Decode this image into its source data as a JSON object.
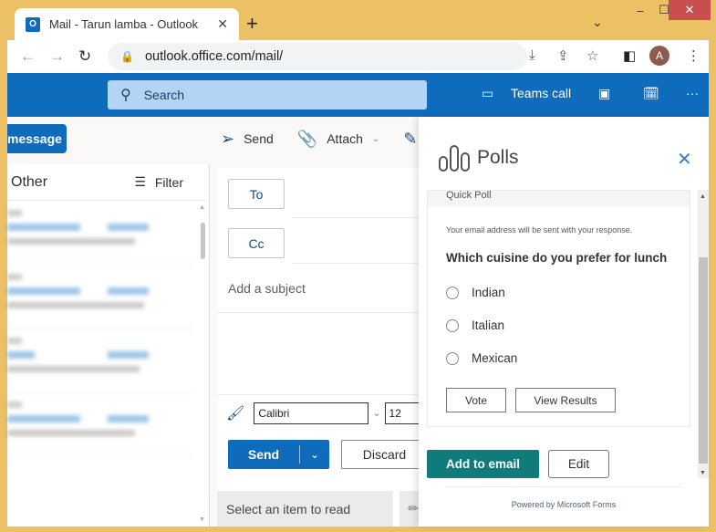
{
  "browser": {
    "tab_title": "Mail - Tarun lamba - Outlook",
    "favicon_letter": "O",
    "tab_close": "✕",
    "new_tab": "+",
    "url": "outlook.office.com/mail/",
    "profile_initial": "A",
    "window_controls": {
      "minimize": "–",
      "maximize": "☐",
      "close": "✕"
    }
  },
  "outlook_header": {
    "search_placeholder": "Search",
    "teams_call_label": "Teams call"
  },
  "left": {
    "new_message_label": "message",
    "folder_label": "Other",
    "filter_label": "Filter",
    "mail_items_count_visible": 4
  },
  "commands": {
    "send_label": "Send",
    "attach_label": "Attach"
  },
  "compose": {
    "to_label": "To",
    "cc_label": "Cc",
    "subject_placeholder": "Add a subject",
    "font_name": "Calibri",
    "font_size": "12",
    "send_label": "Send",
    "discard_label": "Discard",
    "read_placeholder": "Select an item to read"
  },
  "polls": {
    "title": "Polls",
    "card_header": "Quick Poll",
    "notice": "Your email address will be sent with your response.",
    "question": "Which cuisine do you prefer for lunch",
    "options": [
      "Indian",
      "Italian",
      "Mexican"
    ],
    "vote_label": "Vote",
    "view_results_label": "View Results",
    "add_to_email_label": "Add to email",
    "edit_label": "Edit",
    "powered_by": "Powered by Microsoft Forms"
  },
  "colors": {
    "outlook_blue": "#0f6cbd",
    "forms_teal": "#0f7b7b",
    "window_frame": "#ecc165"
  }
}
